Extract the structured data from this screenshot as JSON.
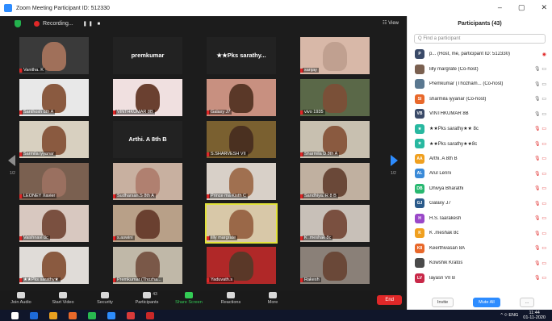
{
  "window": {
    "title": "Zoom Meeting Participant ID: 512330",
    "controls": [
      "–",
      "▢",
      "✕"
    ]
  },
  "stage": {
    "recording_label": "Recording...",
    "recording_controls": "❚❚ ■",
    "view_label": "☷ View",
    "page_left": "1/2",
    "page_right": "1/2"
  },
  "tiles": [
    {
      "name": "Vanitha. K",
      "face": "#a0705a",
      "bg": "#3a3a3a"
    },
    {
      "name": "premkumar",
      "big": true
    },
    {
      "name": "★★Pks sarathy...",
      "big": true
    },
    {
      "name": "sanjay",
      "face": "#c0a090",
      "bg": "#d8b8a8"
    },
    {
      "name": "Santhosh 8th A",
      "face": "#8a5a40",
      "bg": "#e8e8e8"
    },
    {
      "name": "VINTHKUMAR 8B",
      "face": "#6a4030",
      "bg": "#f0e0e0"
    },
    {
      "name": "Galaxy J7",
      "face": "#5a3828",
      "bg": "#c89080"
    },
    {
      "name": "vivo 1935",
      "face": "#7a5038",
      "bg": "#5a6848"
    },
    {
      "name": "Sarmila iyyanar",
      "face": "#8a5a40",
      "bg": "#d8d0c0"
    },
    {
      "name": "Arthi. A 8th B",
      "big": true
    },
    {
      "name": "S.SHARVESH VII",
      "face": "#4a3020",
      "bg": "#7a6030"
    },
    {
      "name": "Sharmila D 8th A",
      "face": "#8a5a40",
      "bg": "#c8c0b0"
    },
    {
      "name": "LEONEY Xavier",
      "face": "#9a7060",
      "bg": "#7a6050"
    },
    {
      "name": "Sudharsan.S 8th A",
      "face": "#b08070",
      "bg": "#c8b0a0"
    },
    {
      "name": "Prince ma Kisth C",
      "face": "#a07050",
      "bg": "#d8d0c8"
    },
    {
      "name": "Sandhiya. R 8 B",
      "face": "#6a4838",
      "bg": "#c0b0a0"
    },
    {
      "name": "Vaishnavi 8c",
      "face": "#7a5040",
      "bg": "#d8c8c0"
    },
    {
      "name": "s.aswini",
      "face": "#6a4030",
      "bg": "#b8a088"
    },
    {
      "name": "lilly margrate",
      "face": "#9a6848",
      "bg": "#d8c8a8",
      "active": true
    },
    {
      "name": "K .meshak 8c",
      "face": "#7a5040",
      "bg": "#c8c0b8"
    },
    {
      "name": "★★Pks sarathy★",
      "face": "#8a5a40",
      "bg": "#e0dcd8"
    },
    {
      "name": "Premkumar (Thozha...",
      "face": "#7a5848",
      "bg": "#c0b8a8"
    },
    {
      "name": "Yaduvath.s",
      "face": "#5a3828",
      "bg": "#b02828"
    },
    {
      "name": "Rakesh",
      "face": "#6a4838",
      "bg": "#8a8078"
    }
  ],
  "controls": [
    {
      "label": "Join Audio",
      "icon": "headphones-icon"
    },
    {
      "label": "Start Video",
      "icon": "video-off-icon"
    },
    {
      "label": "Security",
      "icon": "shield-icon"
    },
    {
      "label": "Participants",
      "icon": "participants-icon",
      "count": "43"
    },
    {
      "label": "Share Screen",
      "icon": "share-screen-icon"
    },
    {
      "label": "Reactions",
      "icon": "reactions-icon"
    },
    {
      "label": "More",
      "icon": "more-icon"
    }
  ],
  "end_label": "End",
  "participants": {
    "header": "Participants (43)",
    "search_placeholder": "Q  Find a participant",
    "list": [
      {
        "initials": "P",
        "color": "#3a4a68",
        "name": "p...  (Host, me, participant ID: 512330)",
        "status": "◉",
        "red": true
      },
      {
        "initials": "",
        "color": "#7a6050",
        "name": "lilly margrate (Co-host)",
        "status": "🎙 ▭"
      },
      {
        "initials": "",
        "color": "#5a7890",
        "name": "Premkumar (Thozham... (Co-host)",
        "status": "🎙 ▭"
      },
      {
        "initials": "SI",
        "color": "#e8682a",
        "name": "sharmila iyyanar (Co-host)",
        "status": "🎙 ▭"
      },
      {
        "initials": "VB",
        "color": "#3a4a68",
        "name": "VINTHKUMAR 8B",
        "status": "🎙 ▭"
      },
      {
        "initials": "★",
        "color": "#28b8a0",
        "name": "★★Pks sarathy★★ 8c",
        "status": "🎙 ▭",
        "red": true
      },
      {
        "initials": "★",
        "color": "#28b8a0",
        "name": "★★Pks sarathy★★8c",
        "status": "🎙 ▭",
        "red": true
      },
      {
        "initials": "AA",
        "color": "#f0a020",
        "name": "Arthi. A 8th B",
        "status": "🎙 ▭",
        "red": true
      },
      {
        "initials": "AL",
        "color": "#3a8ad8",
        "name": "Arul Lenni",
        "status": "🎙 ▭",
        "red": true
      },
      {
        "initials": "DB",
        "color": "#28b870",
        "name": "Dhivya Bharathi",
        "status": "🎙 ▭",
        "red": true
      },
      {
        "initials": "GJ",
        "color": "#2a5a8a",
        "name": "Galaxy J7",
        "status": "🎙 ▭",
        "red": true
      },
      {
        "initials": "H",
        "color": "#9a48c8",
        "name": "H.S.Taarakesh",
        "status": "🎙 ▭",
        "red": true
      },
      {
        "initials": "K",
        "color": "#f0a020",
        "name": "K .meshak 8c",
        "status": "🎙 ▭",
        "red": true
      },
      {
        "initials": "K8",
        "color": "#e8682a",
        "name": "Keerthivasan 8A",
        "status": "🎙 ▭",
        "red": true
      },
      {
        "initials": "",
        "color": "#4a4a4a",
        "name": "Kowshik Kratos",
        "status": "🎙 ▭",
        "red": true
      },
      {
        "initials": "LV",
        "color": "#c82848",
        "name": "layasri VII B",
        "status": "🎙 ▭",
        "red": true
      }
    ],
    "invite_label": "Invite",
    "mute_all_label": "Mute All",
    "more_label": "..."
  },
  "taskbar": {
    "apps": [
      "#1e6ad8",
      "#e8a020",
      "#e8682a",
      "#28b850",
      "#2d8cff",
      "#d83a3a",
      "#c82828"
    ],
    "tray": "^ ⟐ ENG",
    "time": "11:44",
    "date": "01-11-2020"
  }
}
